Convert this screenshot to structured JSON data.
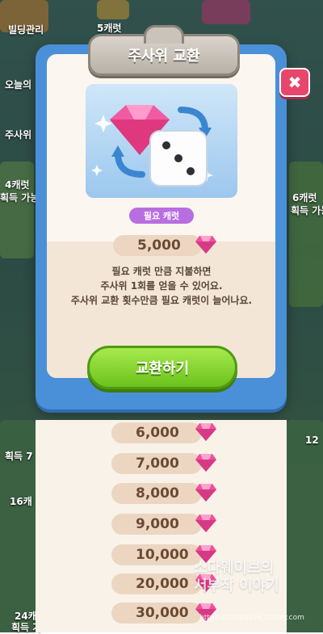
{
  "background": {
    "labels": [
      {
        "text": "빌딩관리"
      },
      {
        "text": "5캐럿"
      },
      {
        "text": "오늘의"
      },
      {
        "text": "주사위"
      },
      {
        "text": "4캐럿"
      },
      {
        "text": "획득 가능"
      },
      {
        "text": "6캐럿"
      },
      {
        "text": "획득 가능"
      },
      {
        "text": "획득 7"
      },
      {
        "text": "16캐"
      },
      {
        "text": "12"
      },
      {
        "text": "24캐"
      },
      {
        "text": "획득 가"
      }
    ]
  },
  "modal": {
    "title": "주사위 교환",
    "close_label": "✖",
    "required_label": "필요 캐럿",
    "cost": "5,000",
    "description": [
      "필요 캐럿 만큼 지불하면",
      "주사위 1회를 얻을 수 있어요.",
      "주사위 교환 횟수만큼 필요 캐럿이 늘어나요."
    ],
    "exchange_button": "교환하기"
  },
  "cost_list": [
    "6,000",
    "7,000",
    "8,000",
    "9,000",
    "10,000",
    "20,000",
    "30,000"
  ],
  "watermark": {
    "line1": "소다웨이브의",
    "line2": "서부작 이야기",
    "url": "https://sodawave.tistory.com"
  },
  "colors": {
    "modal_frame": "#4a90d9",
    "gem": "#f0509a",
    "exchange_button": "#7fd22a",
    "close_button": "#e8466a",
    "pill_label": "#b86ee0"
  },
  "icons": [
    "gem-icon",
    "dice-icon",
    "swap-arrows-icon",
    "close-icon"
  ]
}
